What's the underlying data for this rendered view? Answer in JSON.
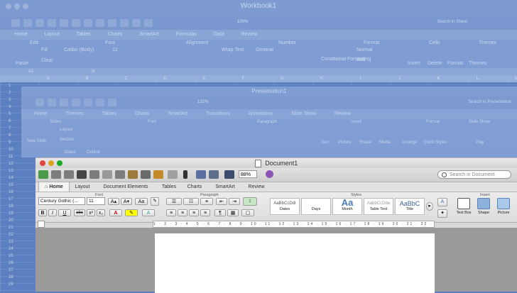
{
  "excel": {
    "title": "Workbook1",
    "zoom": "100%",
    "search_placeholder": "Search in Sheet",
    "tabs": [
      "Home",
      "Layout",
      "Tables",
      "Charts",
      "SmartArt",
      "Formulas",
      "Data",
      "Review"
    ],
    "groups": [
      "Edit",
      "Font",
      "Alignment",
      "Number",
      "Format",
      "Cells",
      "Themes"
    ],
    "font_name": "Calibri (Body)",
    "font_size": "12",
    "fill_label": "Fill",
    "clear_label": "Clear",
    "paste_label": "Paste",
    "wrap_label": "Wrap Text",
    "number_format": "General",
    "cond_format_label": "Conditional Formatting",
    "style_normal": "Normal",
    "style_bad": "Bad",
    "cells_buttons": [
      "Insert",
      "Delete",
      "Format"
    ],
    "themes_label": "Themes",
    "cell_ref": "A1",
    "fx": "fx",
    "columns": [
      "A",
      "B",
      "C",
      "D",
      "E",
      "F",
      "G",
      "H",
      "I",
      "J",
      "K",
      "L",
      "M"
    ],
    "rows": [
      "1",
      "2",
      "3",
      "4",
      "5",
      "6",
      "7",
      "8",
      "9",
      "10",
      "11",
      "12",
      "13",
      "14",
      "15",
      "16",
      "17",
      "18",
      "19",
      "20",
      "21",
      "22",
      "23",
      "24",
      "25",
      "26",
      "27",
      "28",
      "29"
    ]
  },
  "powerpoint": {
    "title": "Presentation1",
    "zoom": "121%",
    "search_placeholder": "Search in Presentation",
    "tabs": [
      "Home",
      "Themes",
      "Tables",
      "Charts",
      "SmartArt",
      "Transitions",
      "Animations",
      "Slide Show",
      "Review"
    ],
    "groups": [
      "Slides",
      "Font",
      "Paragraph",
      "Insert",
      "Format",
      "Slide Show"
    ],
    "new_slide": "New Slide",
    "layout": "Layout",
    "section": "Section",
    "insert_items": [
      "Text",
      "Picture",
      "Shape",
      "Media",
      "Arrange",
      "Quick Styles"
    ],
    "play": "Play",
    "pane_tabs": [
      "Slides",
      "Outline"
    ]
  },
  "word": {
    "title": "Document1",
    "zoom": "88%",
    "search_placeholder": "Search in Document",
    "tabs": [
      "Home",
      "Layout",
      "Document Elements",
      "Tables",
      "Charts",
      "SmartArt",
      "Review"
    ],
    "groups": {
      "font": "Font",
      "paragraph": "Paragraph",
      "styles": "Styles",
      "insert": "Insert"
    },
    "font_name": "Century Gothic (...",
    "font_size": "11",
    "format_buttons": [
      "B",
      "I",
      "U",
      "abc"
    ],
    "styles": [
      {
        "sample": "AaBbCcDdI",
        "label": "Dates"
      },
      {
        "sample": "",
        "label": "Days"
      },
      {
        "sample": "Aa",
        "label": "Month"
      },
      {
        "sample": "AabbCcDde",
        "label": "Table Text"
      },
      {
        "sample": "AaBbC",
        "label": "Title"
      }
    ],
    "insert": [
      "Text Box",
      "Shape",
      "Picture"
    ],
    "ruler": "1 · 2 · 3 · 4 · 5 · 6 · 7 · 8 · 9 · 10 · 11 · 12 · 13 · 14 · 15 · 16 · 17 · 18 · 19 · 20 · 21 · 22 · 23 · 24 · 25 · 26"
  },
  "colors": {
    "accent": "#5b7fc0",
    "word_chrome": "#d8d8d8",
    "page": "#ffffff"
  }
}
